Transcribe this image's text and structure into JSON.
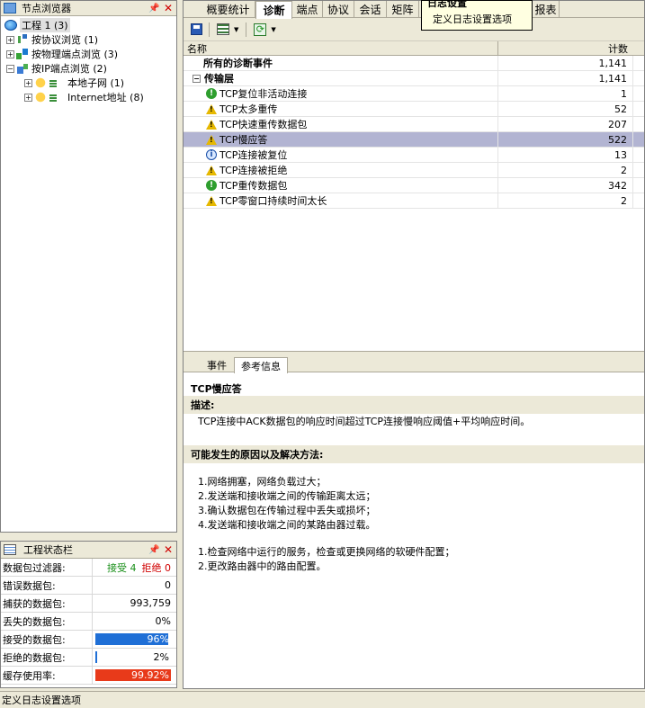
{
  "node_browser": {
    "title": "节点浏览器",
    "tree": [
      {
        "label": "工程 1 (3)"
      },
      {
        "label": "按协议浏览 (1)"
      },
      {
        "label": "按物理端点浏览 (3)"
      },
      {
        "label": "按IP端点浏览 (2)"
      },
      {
        "label": "本地子网 (1)"
      },
      {
        "label": "Internet地址 (8)"
      }
    ]
  },
  "project_status": {
    "title": "工程状态栏",
    "rows": [
      {
        "label": "数据包过滤器:",
        "accept": "接受 4",
        "reject": "拒绝 0"
      },
      {
        "label": "错误数据包:",
        "value": "0"
      },
      {
        "label": "捕获的数据包:",
        "value": "993,759"
      },
      {
        "label": "丢失的数据包:",
        "value": "0%"
      },
      {
        "label": "接受的数据包:",
        "value": "96%",
        "fill": 0.96,
        "color": "#1f6fd6"
      },
      {
        "label": "拒绝的数据包:",
        "value": "2%",
        "fill": 0.02,
        "color": "#1f6fd6"
      },
      {
        "label": "缓存使用率:",
        "value": "99.92%",
        "fill": 0.9992,
        "color": "#e83a1a"
      }
    ]
  },
  "main_tabs": [
    {
      "label": "概要统计"
    },
    {
      "label": "诊断"
    },
    {
      "label": "端点"
    },
    {
      "label": "协议"
    },
    {
      "label": "会话"
    },
    {
      "label": "矩阵"
    },
    {
      "label": "报表"
    }
  ],
  "tooltip": {
    "header": "日志设置",
    "text": "定义日志设置选项"
  },
  "grid": {
    "headers": {
      "name": "名称",
      "count": "计数"
    },
    "rows": [
      {
        "name": "所有的诊断事件",
        "count": "1,141",
        "kind": "total"
      },
      {
        "name": "传输层",
        "count": "1,141",
        "kind": "group"
      },
      {
        "name": "TCP复位非活动连接",
        "count": "1",
        "icon": "ok"
      },
      {
        "name": "TCP太多重传",
        "count": "52",
        "icon": "warn"
      },
      {
        "name": "TCP快速重传数据包",
        "count": "207",
        "icon": "warn"
      },
      {
        "name": "TCP慢应答",
        "count": "522",
        "icon": "warn",
        "selected": true
      },
      {
        "name": "TCP连接被复位",
        "count": "13",
        "icon": "info"
      },
      {
        "name": "TCP连接被拒绝",
        "count": "2",
        "icon": "warn"
      },
      {
        "name": "TCP重传数据包",
        "count": "342",
        "icon": "ok"
      },
      {
        "name": "TCP零窗口持续时间太长",
        "count": "2",
        "icon": "warn"
      }
    ]
  },
  "detail_tabs": [
    {
      "label": "事件"
    },
    {
      "label": "参考信息"
    }
  ],
  "detail": {
    "title": "TCP慢应答",
    "desc_head": "描述:",
    "desc": "TCP连接中ACK数据包的响应时间超过TCP连接慢响应阈值+平均响应时间。",
    "cause_head": "可能发生的原因以及解决方法:",
    "causes": [
      "1.网络拥塞，网络负载过大；",
      "2.发送端和接收端之间的传输距离太远；",
      "3.确认数据包在传输过程中丢失或损坏；",
      "4.发送端和接收端之间的某路由器过载。"
    ],
    "solutions": [
      "1.检查网络中运行的服务，检查或更换网络的软硬件配置；",
      "2.更改路由器中的路由配置。"
    ]
  },
  "status_bar": "定义日志设置选项"
}
